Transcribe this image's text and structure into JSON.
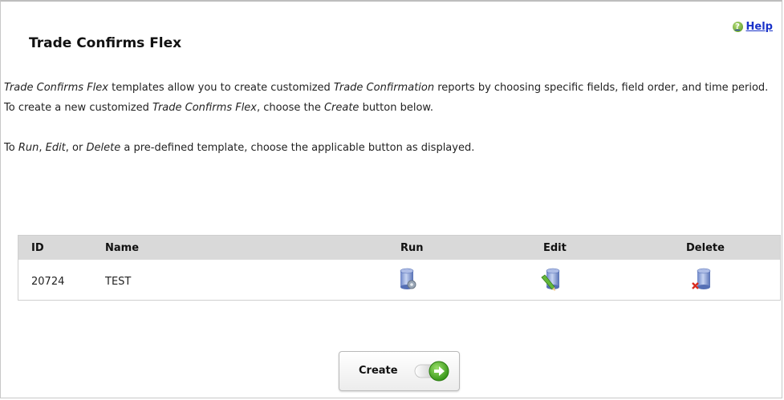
{
  "help": {
    "label": "Help",
    "icon": "question-icon"
  },
  "page": {
    "title": "Trade Confirms Flex"
  },
  "description": {
    "p1": {
      "a": "Trade Confirms Flex",
      "b": " templates allow you to create customized ",
      "c": "Trade Confirmation",
      "d": " reports by choosing specific fields, field order, and time period. To create a new customized ",
      "e": "Trade Confirms Flex",
      "f": ", choose the ",
      "g": "Create",
      "h": " button below."
    },
    "p2": {
      "a": "To ",
      "b": "Run",
      "c": ", ",
      "d": "Edit",
      "e": ", or ",
      "f": "Delete",
      "g": " a pre-defined template, choose the applicable button as displayed."
    }
  },
  "table": {
    "headers": {
      "id": "ID",
      "name": "Name",
      "run": "Run",
      "edit": "Edit",
      "delete": "Delete"
    },
    "rows": [
      {
        "id": "20724",
        "name": "TEST",
        "run_icon": "run-gear-icon",
        "edit_icon": "edit-pencil-icon",
        "delete_icon": "delete-x-icon"
      }
    ]
  },
  "create_button": {
    "label": "Create",
    "icon": "arrow-right-icon"
  },
  "colors": {
    "help_link": "#1a33c9",
    "header_bg": "#d9d9d9",
    "arrow_green": "#3aa815"
  }
}
